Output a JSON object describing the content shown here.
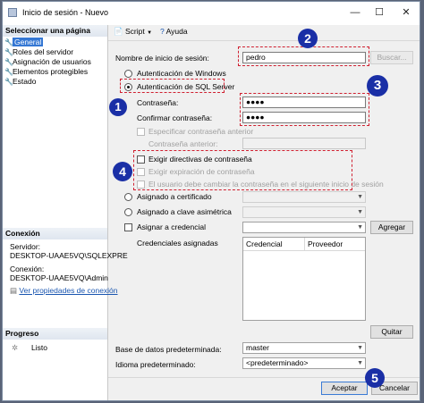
{
  "window": {
    "title": "Inicio de sesión - Nuevo",
    "minimize": "—",
    "maximize": "☐",
    "close": "✕"
  },
  "left": {
    "select_page": "Seleccionar una página",
    "pages": [
      "General",
      "Roles del servidor",
      "Asignación de usuarios",
      "Elementos protegibles",
      "Estado"
    ],
    "connection_header": "Conexión",
    "server_label": "Servidor:",
    "server_value": "DESKTOP-UAAE5VQ\\SQLEXPRE",
    "connection_label": "Conexión:",
    "connection_value": "DESKTOP-UAAE5VQ\\Admin",
    "view_props": "Ver propiedades de conexión",
    "progress_header": "Progreso",
    "progress_status": "Listo"
  },
  "toolbar": {
    "script": "Script",
    "help": "Ayuda"
  },
  "form": {
    "login_name_label": "Nombre de inicio de sesión:",
    "login_name_value": "pedro",
    "search_button": "Buscar...",
    "windows_auth": "Autenticación de Windows",
    "sql_auth": "Autenticación de SQL Server",
    "password_label": "Contraseña:",
    "password_value": "●●●●",
    "confirm_label": "Confirmar contraseña:",
    "confirm_value": "●●●●",
    "specify_old": "Especificar contraseña anterior",
    "old_password_label": "Contraseña anterior:",
    "enforce_policy": "Exigir directivas de contraseña",
    "enforce_expiration": "Exigir expiración de contraseña",
    "must_change": "El usuario debe cambiar la contraseña en el siguiente inicio de sesión",
    "mapped_cert": "Asignado a certificado",
    "mapped_asym": "Asignado a clave asimétrica",
    "map_credential": "Asignar a credencial",
    "add_button": "Agregar",
    "mapped_credentials": "Credenciales asignadas",
    "col_credential": "Credencial",
    "col_provider": "Proveedor",
    "remove_button": "Quitar",
    "default_db_label": "Base de datos predeterminada:",
    "default_db_value": "master",
    "default_lang_label": "Idioma predeterminado:",
    "default_lang_value": "<predeterminado>"
  },
  "footer": {
    "ok": "Aceptar",
    "cancel": "Cancelar"
  },
  "annotations": [
    "1",
    "2",
    "3",
    "4",
    "5"
  ],
  "colors": {
    "accent": "#3477d4",
    "annotation": "#d02030",
    "badge": "#1a2fa6"
  }
}
